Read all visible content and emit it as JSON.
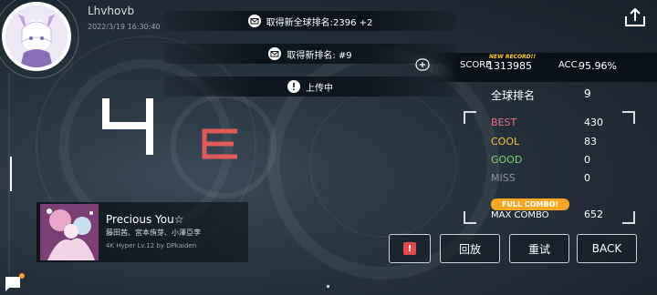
{
  "user": {
    "name": "Lhvhovb",
    "datetime": "2022/3/19 16:30:40"
  },
  "notifications": [
    {
      "icon": "mail-icon",
      "text": "取得新全球排名:2396 +2"
    },
    {
      "icon": "mail-icon",
      "text": "取得新排名: #9"
    },
    {
      "icon": "alert-icon",
      "text": "上传中"
    }
  ],
  "result": {
    "rank_glyph": "4",
    "grade": "E"
  },
  "song": {
    "title": "Precious You☆",
    "artist": "藤田茜、宮本侑芽、小澤亞李",
    "difficulty": "4K Hyper  Lv.12 by DPkaiden"
  },
  "score": {
    "new_record": "NEW RECORD!!",
    "label": "SCORE",
    "value": "1313985",
    "acc_label": "ACC.",
    "acc_value": "95.96%"
  },
  "global_rank": {
    "label": "全球排名",
    "value": "9"
  },
  "judgements": [
    {
      "label": "BEST",
      "value": "430",
      "color": "#f06b82"
    },
    {
      "label": "COOL",
      "value": "83",
      "color": "#f5c542"
    },
    {
      "label": "GOOD",
      "value": "0",
      "color": "#7bd66b"
    },
    {
      "label": "MISS",
      "value": "0",
      "color": "#8c949c"
    }
  ],
  "combo": {
    "badge": "FULL COMBO!",
    "label": "MAX COMBO",
    "value": "652"
  },
  "buttons": {
    "report": "!",
    "replay": "回放",
    "retry": "重试",
    "back": "BACK"
  },
  "colors": {
    "grade": "#e05a5a",
    "full_combo": "#f5a623",
    "report": "#e04a4a",
    "new_record": "#ffcc33"
  }
}
